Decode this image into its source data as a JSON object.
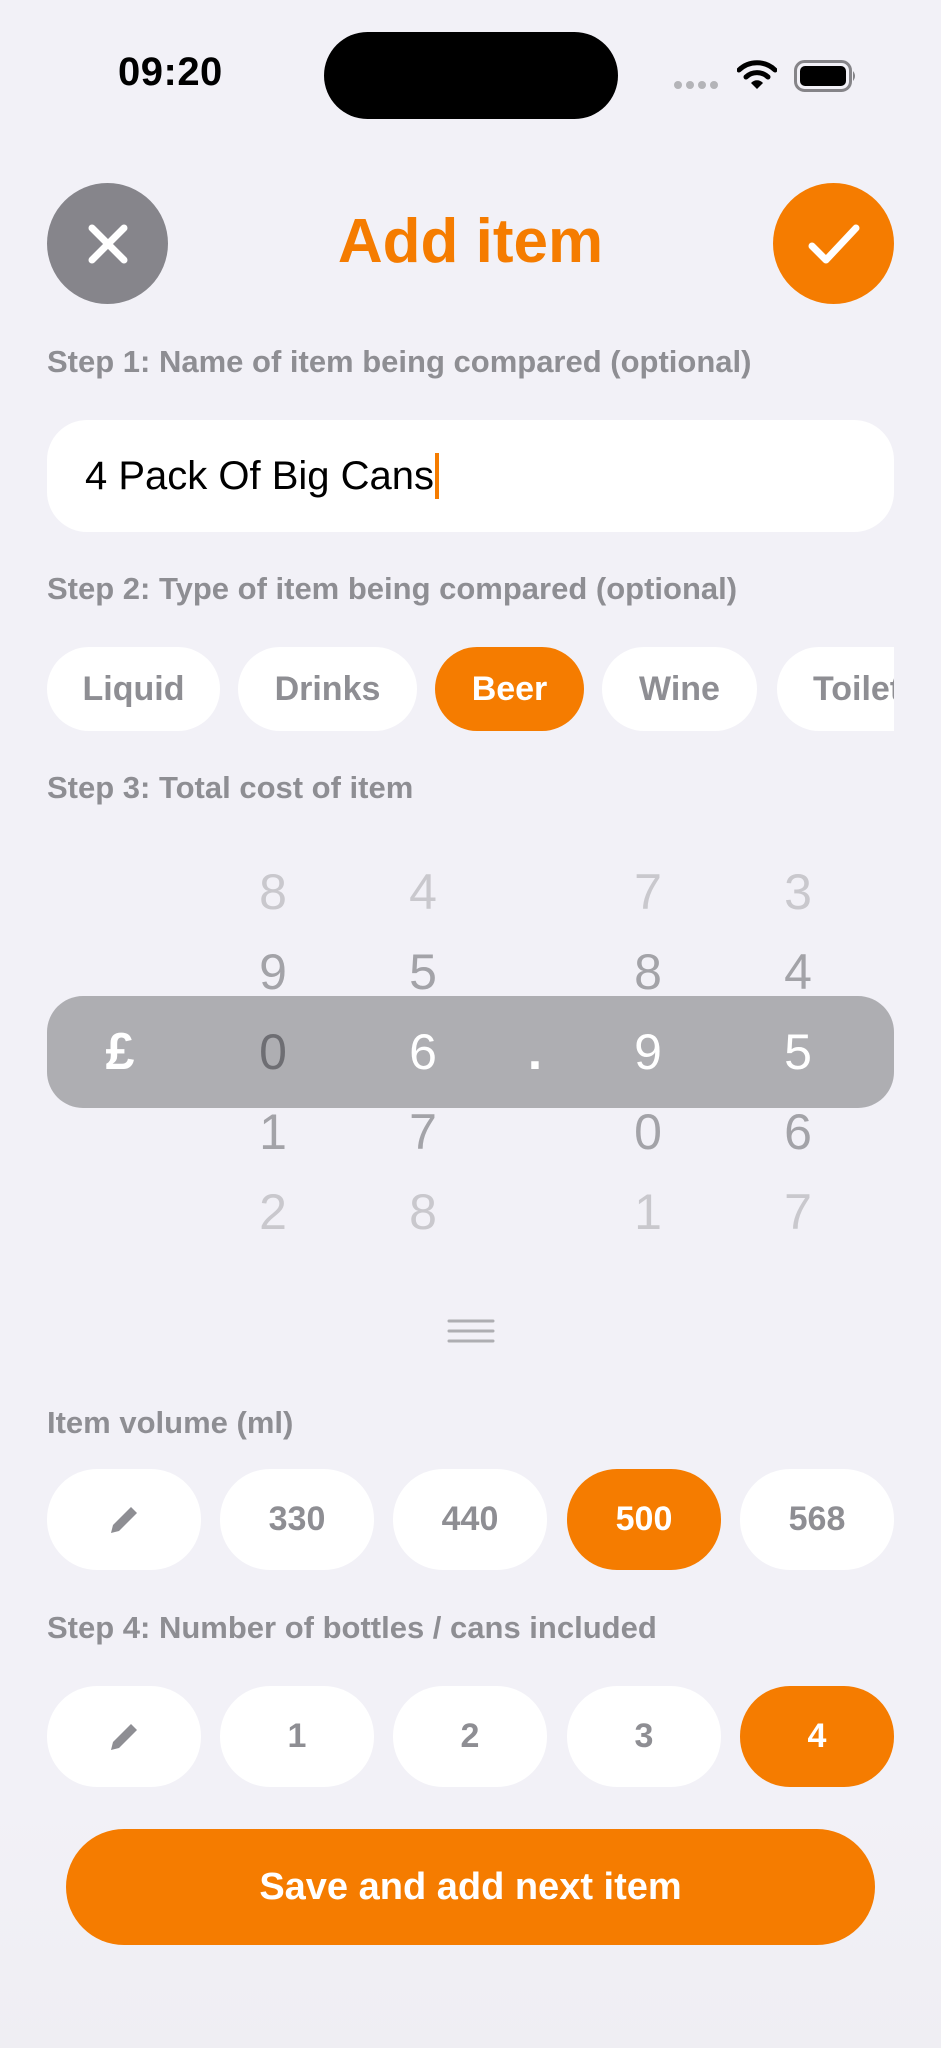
{
  "status_bar": {
    "time": "09:20",
    "icons": [
      "signal-dots-icon",
      "wifi-icon",
      "battery-icon"
    ]
  },
  "header": {
    "title": "Add item",
    "close_icon": "close-icon",
    "confirm_icon": "checkmark-icon"
  },
  "step1": {
    "label": "Step 1: Name of item being compared (optional)",
    "value": "4 Pack Of Big Cans"
  },
  "step2": {
    "label": "Step 2: Type of item being compared (optional)",
    "types": [
      "Liquid",
      "Drinks",
      "Beer",
      "Wine",
      "Toilet"
    ],
    "selected": "Beer"
  },
  "step3": {
    "label": "Step 3: Total cost of item",
    "currency": "£",
    "decimal": ".",
    "value": "06.95",
    "columns": [
      {
        "digits": [
          "8",
          "9",
          "0",
          "1",
          "2"
        ]
      },
      {
        "digits": [
          "4",
          "5",
          "6",
          "7",
          "8"
        ]
      },
      {
        "digits": [
          "7",
          "8",
          "9",
          "0",
          "1"
        ]
      },
      {
        "digits": [
          "3",
          "4",
          "5",
          "6",
          "7"
        ]
      }
    ]
  },
  "volume": {
    "label": "Item volume (ml)",
    "edit_icon": "pencil-icon",
    "options": [
      "330",
      "440",
      "500",
      "568"
    ],
    "selected": "500"
  },
  "step4": {
    "label": "Step 4: Number of bottles / cans included",
    "edit_icon": "pencil-icon",
    "options": [
      "1",
      "2",
      "3",
      "4"
    ],
    "selected": "4"
  },
  "save_button": {
    "label": "Save and add next item"
  },
  "colors": {
    "accent": "#f57c00",
    "background": "#f2f1f7",
    "secondary_text": "#8e8e93",
    "close_button": "#86858b",
    "picker_band": "#aeaeb2"
  }
}
